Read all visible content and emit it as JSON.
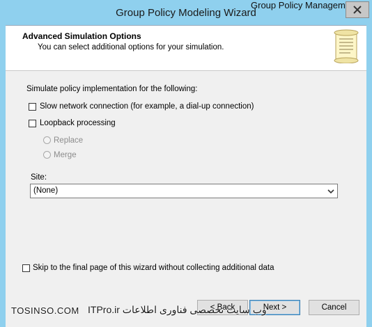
{
  "window": {
    "title": "Group Policy Modeling Wizard",
    "background_peek": "Group Policy Management",
    "accent_color": "#8fd0ee"
  },
  "header": {
    "title": "Advanced Simulation Options",
    "subtitle": "You can select additional options for your simulation.",
    "icon": "scroll-icon"
  },
  "main": {
    "prompt": "Simulate policy implementation for the following:",
    "slow_network": {
      "label": "Slow network connection (for example, a dial-up connection)",
      "checked": false
    },
    "loopback": {
      "label": "Loopback processing",
      "checked": false
    },
    "loopback_modes": [
      {
        "label": "Replace",
        "selected": false,
        "enabled": false
      },
      {
        "label": "Merge",
        "selected": false,
        "enabled": false
      }
    ],
    "site_label": "Site:",
    "site_value": "(None)",
    "skip": {
      "label": "Skip to the final page of this wizard without collecting additional data",
      "checked": false
    }
  },
  "buttons": {
    "back": "< Back",
    "next": "Next >",
    "cancel": "Cancel"
  },
  "watermark": {
    "left": "TOSINSO.COM",
    "right": "وب سایت تخصصی فناوری اطلاعات ITPro.ir"
  }
}
